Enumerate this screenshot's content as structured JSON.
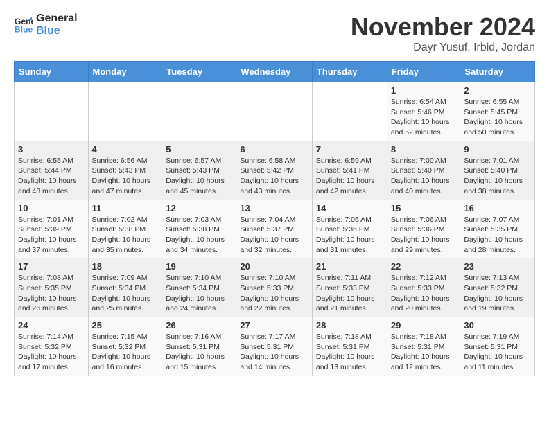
{
  "header": {
    "logo_line1": "General",
    "logo_line2": "Blue",
    "month_year": "November 2024",
    "location": "Dayr Yusuf, Irbid, Jordan"
  },
  "days_of_week": [
    "Sunday",
    "Monday",
    "Tuesday",
    "Wednesday",
    "Thursday",
    "Friday",
    "Saturday"
  ],
  "weeks": [
    [
      {
        "day": "",
        "info": ""
      },
      {
        "day": "",
        "info": ""
      },
      {
        "day": "",
        "info": ""
      },
      {
        "day": "",
        "info": ""
      },
      {
        "day": "",
        "info": ""
      },
      {
        "day": "1",
        "info": "Sunrise: 6:54 AM\nSunset: 5:46 PM\nDaylight: 10 hours\nand 52 minutes."
      },
      {
        "day": "2",
        "info": "Sunrise: 6:55 AM\nSunset: 5:45 PM\nDaylight: 10 hours\nand 50 minutes."
      }
    ],
    [
      {
        "day": "3",
        "info": "Sunrise: 6:55 AM\nSunset: 5:44 PM\nDaylight: 10 hours\nand 48 minutes."
      },
      {
        "day": "4",
        "info": "Sunrise: 6:56 AM\nSunset: 5:43 PM\nDaylight: 10 hours\nand 47 minutes."
      },
      {
        "day": "5",
        "info": "Sunrise: 6:57 AM\nSunset: 5:43 PM\nDaylight: 10 hours\nand 45 minutes."
      },
      {
        "day": "6",
        "info": "Sunrise: 6:58 AM\nSunset: 5:42 PM\nDaylight: 10 hours\nand 43 minutes."
      },
      {
        "day": "7",
        "info": "Sunrise: 6:59 AM\nSunset: 5:41 PM\nDaylight: 10 hours\nand 42 minutes."
      },
      {
        "day": "8",
        "info": "Sunrise: 7:00 AM\nSunset: 5:40 PM\nDaylight: 10 hours\nand 40 minutes."
      },
      {
        "day": "9",
        "info": "Sunrise: 7:01 AM\nSunset: 5:40 PM\nDaylight: 10 hours\nand 38 minutes."
      }
    ],
    [
      {
        "day": "10",
        "info": "Sunrise: 7:01 AM\nSunset: 5:39 PM\nDaylight: 10 hours\nand 37 minutes."
      },
      {
        "day": "11",
        "info": "Sunrise: 7:02 AM\nSunset: 5:38 PM\nDaylight: 10 hours\nand 35 minutes."
      },
      {
        "day": "12",
        "info": "Sunrise: 7:03 AM\nSunset: 5:38 PM\nDaylight: 10 hours\nand 34 minutes."
      },
      {
        "day": "13",
        "info": "Sunrise: 7:04 AM\nSunset: 5:37 PM\nDaylight: 10 hours\nand 32 minutes."
      },
      {
        "day": "14",
        "info": "Sunrise: 7:05 AM\nSunset: 5:36 PM\nDaylight: 10 hours\nand 31 minutes."
      },
      {
        "day": "15",
        "info": "Sunrise: 7:06 AM\nSunset: 5:36 PM\nDaylight: 10 hours\nand 29 minutes."
      },
      {
        "day": "16",
        "info": "Sunrise: 7:07 AM\nSunset: 5:35 PM\nDaylight: 10 hours\nand 28 minutes."
      }
    ],
    [
      {
        "day": "17",
        "info": "Sunrise: 7:08 AM\nSunset: 5:35 PM\nDaylight: 10 hours\nand 26 minutes."
      },
      {
        "day": "18",
        "info": "Sunrise: 7:09 AM\nSunset: 5:34 PM\nDaylight: 10 hours\nand 25 minutes."
      },
      {
        "day": "19",
        "info": "Sunrise: 7:10 AM\nSunset: 5:34 PM\nDaylight: 10 hours\nand 24 minutes."
      },
      {
        "day": "20",
        "info": "Sunrise: 7:10 AM\nSunset: 5:33 PM\nDaylight: 10 hours\nand 22 minutes."
      },
      {
        "day": "21",
        "info": "Sunrise: 7:11 AM\nSunset: 5:33 PM\nDaylight: 10 hours\nand 21 minutes."
      },
      {
        "day": "22",
        "info": "Sunrise: 7:12 AM\nSunset: 5:33 PM\nDaylight: 10 hours\nand 20 minutes."
      },
      {
        "day": "23",
        "info": "Sunrise: 7:13 AM\nSunset: 5:32 PM\nDaylight: 10 hours\nand 19 minutes."
      }
    ],
    [
      {
        "day": "24",
        "info": "Sunrise: 7:14 AM\nSunset: 5:32 PM\nDaylight: 10 hours\nand 17 minutes."
      },
      {
        "day": "25",
        "info": "Sunrise: 7:15 AM\nSunset: 5:32 PM\nDaylight: 10 hours\nand 16 minutes."
      },
      {
        "day": "26",
        "info": "Sunrise: 7:16 AM\nSunset: 5:31 PM\nDaylight: 10 hours\nand 15 minutes."
      },
      {
        "day": "27",
        "info": "Sunrise: 7:17 AM\nSunset: 5:31 PM\nDaylight: 10 hours\nand 14 minutes."
      },
      {
        "day": "28",
        "info": "Sunrise: 7:18 AM\nSunset: 5:31 PM\nDaylight: 10 hours\nand 13 minutes."
      },
      {
        "day": "29",
        "info": "Sunrise: 7:18 AM\nSunset: 5:31 PM\nDaylight: 10 hours\nand 12 minutes."
      },
      {
        "day": "30",
        "info": "Sunrise: 7:19 AM\nSunset: 5:31 PM\nDaylight: 10 hours\nand 11 minutes."
      }
    ]
  ]
}
